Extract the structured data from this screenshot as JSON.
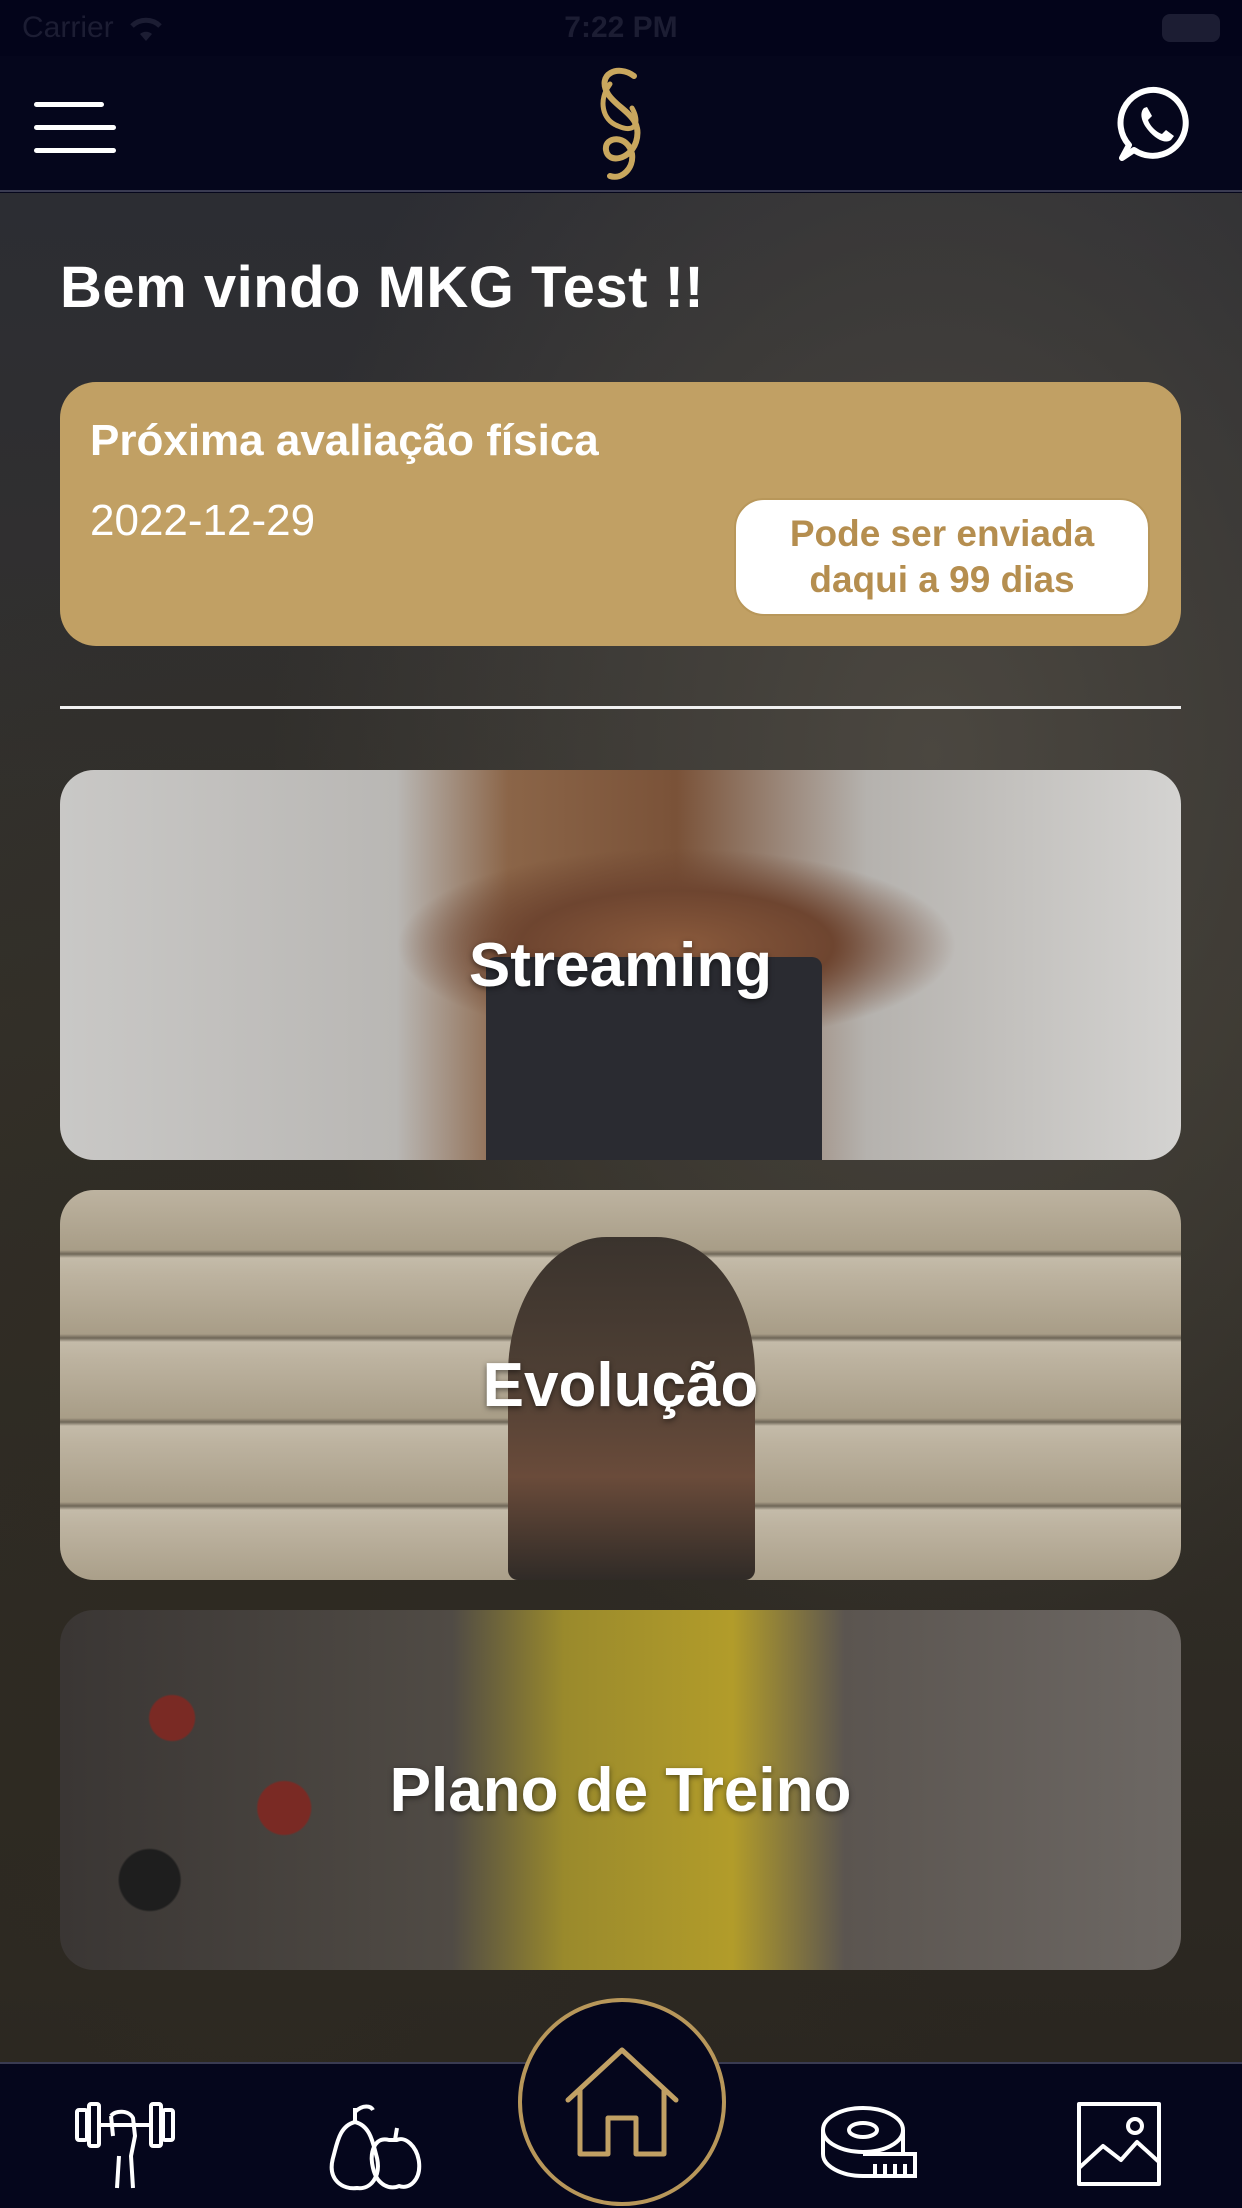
{
  "status_bar": {
    "carrier": "Carrier",
    "time": "7:22 PM"
  },
  "header": {
    "menu_icon": "hamburger-menu-icon",
    "logo_icon": "brand-logo-icon",
    "whatsapp_icon": "whatsapp-icon"
  },
  "welcome": "Bem vindo MKG Test !!",
  "evaluation": {
    "title": "Próxima avaliação física",
    "date": "2022-12-29",
    "button_line1": "Pode ser enviada",
    "button_line2": "daqui a 99 dias"
  },
  "tiles": [
    {
      "label": "Streaming"
    },
    {
      "label": "Evolução"
    },
    {
      "label": "Plano de Treino"
    }
  ],
  "tab_bar": {
    "items": [
      "workout-icon",
      "nutrition-icon",
      "home-icon",
      "measure-tape-icon",
      "gallery-icon"
    ]
  },
  "colors": {
    "gold": "#c1a064",
    "navy": "#05061c"
  }
}
